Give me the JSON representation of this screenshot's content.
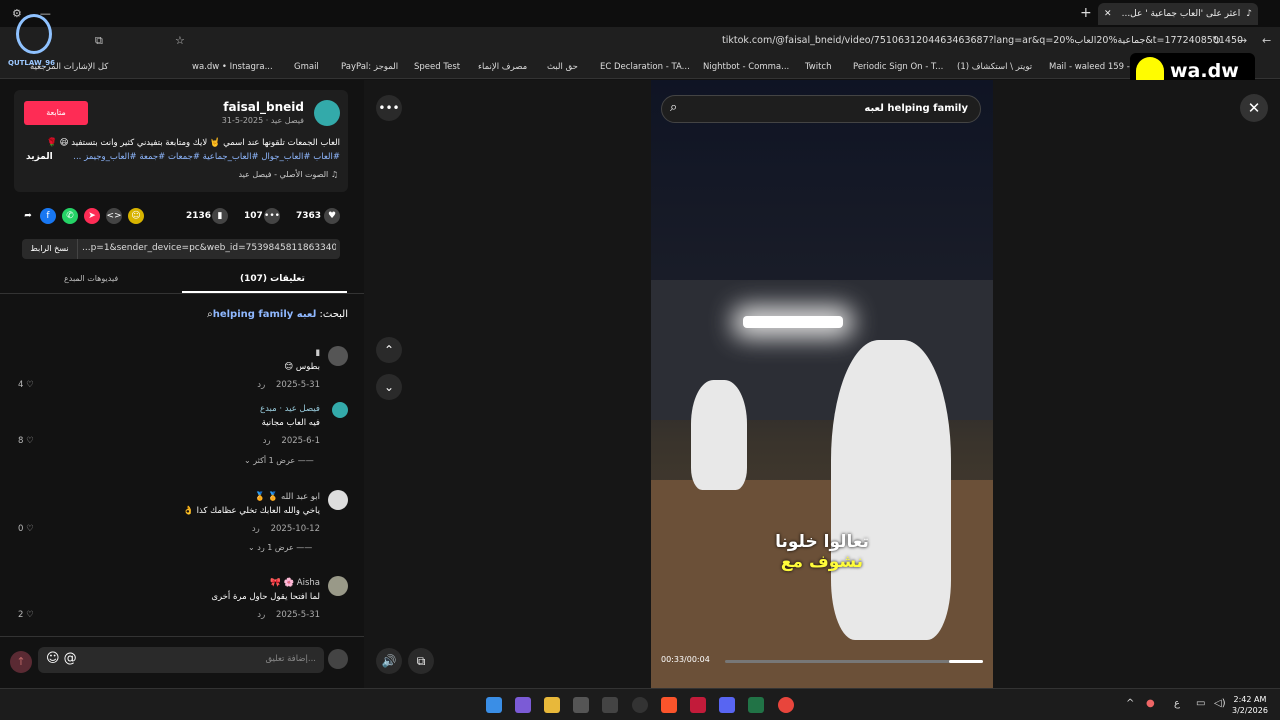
{
  "browser": {
    "tab_title": "اعثر على 'العاب جماعية ' عل...",
    "url": "tiktok.com/@faisal_bneid/video/7510631204463463687?lang=ar&q=20%جماعية%20العاب&t=1772408501450",
    "bookmarks": [
      "كل الإشارات المرجعية",
      "wa.dw • Instagra...",
      "Gmail",
      "PayPal: الموجز",
      "Speed Test",
      "مصرف الإنماء",
      "حق البث",
      "EC Declaration - TA...",
      "Nightbot - Comma...",
      "Twitch",
      "Periodic Sign On - T...",
      "(1) تويتر \\ استكشاف",
      "Mail - waleed 159 -..."
    ]
  },
  "overlay": {
    "logo_text": "QUTLAW_96",
    "snap_name": "wa.dw"
  },
  "post": {
    "follow_label": "متابعة",
    "username": "faisal_bneid",
    "date_line": "فيصل عيد · 2025-5-31",
    "desc": "العاب الجمعات تلقونها عند اسمي 🤘 لايك ومتابعة بتفيدني كثير وانت بتستفيد 😆 🌹",
    "tags": "#العاب #العاب_جوال #العاب_جماعية #جمعات #جمعة #العاب_وجيمز ...",
    "more": "المزيد",
    "sound": "♫ الصوت الأصلي - فيصل عيد"
  },
  "stats": {
    "likes": "7363",
    "comments": "107",
    "saves": "2136"
  },
  "link": {
    "copy_label": "نسخ الرابط",
    "url": "...p=1&sender_device=pc&web_id=7539845811863340551"
  },
  "tabs": {
    "comments": "تعليقات (107)",
    "creator": "فيديوهات المبدع"
  },
  "search_line": {
    "prefix": "البحث: ",
    "query": "لعبه helping family"
  },
  "comments": [
    {
      "name": "▮",
      "text": "بطوس 😊",
      "date": "2025-5-31",
      "reply": "رد",
      "likes": "4 ♡"
    },
    {
      "name": "فيصل عيد · مبدع",
      "text": "فيه العاب مجانية",
      "date": "2025-6-1",
      "reply": "رد",
      "likes": "8 ♡"
    },
    {
      "name": "ابو عبد الله 🏅 🏅",
      "text": "ياخي والله العابك تخلي عظامك كذا 👌",
      "date": "2025-10-12",
      "reply": "رد",
      "likes": "0 ♡"
    },
    {
      "name": "Aisha 🌸 🎀",
      "text": "لما افتحا يقول حاول مرة أخرى",
      "date": "2025-5-31",
      "reply": "رد",
      "likes": "2 ♡"
    }
  ],
  "reply_toggles": [
    "عرض 1 أكثر",
    "عرض 1 رد"
  ],
  "input": {
    "placeholder": "إضافة تعليق..."
  },
  "video": {
    "search_query": "لعبه helping family",
    "caption_line1": "تعالوا خلونا",
    "caption_line2": "نشوف مع",
    "time": "00:33/00:04",
    "progress": 0.13
  },
  "clock": {
    "time": "2:42 AM",
    "date": "3/2/2026"
  },
  "colors": {
    "accent": "#fe2c55",
    "tag": "#8fb8ff"
  }
}
